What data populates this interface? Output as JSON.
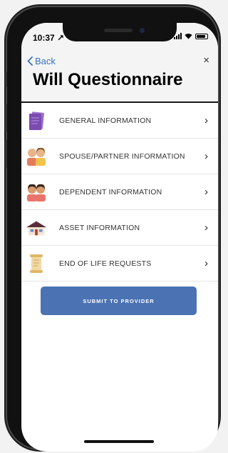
{
  "status_bar": {
    "time": "10:37 ↗"
  },
  "nav": {
    "back_label": "Back",
    "close_label": "×",
    "title": "Will Questionnaire"
  },
  "list": {
    "items": [
      {
        "label": "GENERAL INFORMATION",
        "icon": "document-stack-icon"
      },
      {
        "label": "SPOUSE/PARTNER INFORMATION",
        "icon": "couple-icon"
      },
      {
        "label": "DEPENDENT INFORMATION",
        "icon": "dependents-icon"
      },
      {
        "label": "ASSET INFORMATION",
        "icon": "house-icon"
      },
      {
        "label": "END OF LIFE REQUESTS",
        "icon": "scroll-icon"
      }
    ],
    "chevron": "›"
  },
  "submit": {
    "label": "SUBMIT TO PROVIDER"
  },
  "colors": {
    "accent": "#3a72c4",
    "button": "#4b72b3",
    "icon_purple": "#7b4bb0"
  }
}
